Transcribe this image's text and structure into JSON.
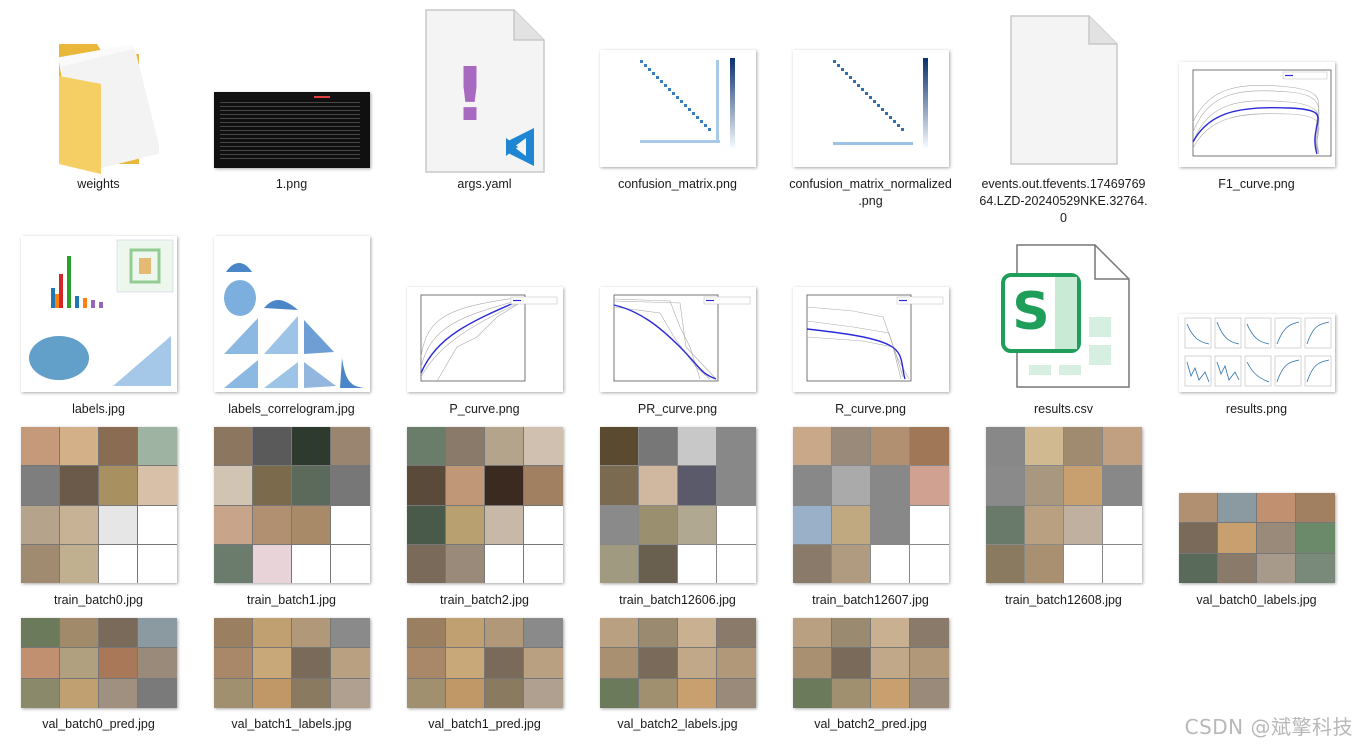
{
  "files": [
    {
      "name": "weights",
      "type": "folder"
    },
    {
      "name": "1.png",
      "type": "terminal-image"
    },
    {
      "name": "args.yaml",
      "type": "yaml-file"
    },
    {
      "name": "confusion_matrix.png",
      "type": "matrix-image"
    },
    {
      "name": "confusion_matrix_normalized.png",
      "display": "confusion_matrix_normalized\n.png",
      "type": "matrix-image"
    },
    {
      "name": "events.out.tfevents.1746976964.LZD-20240529NKE.32764.0",
      "display": "events.out.tfevents.17469769\n64.LZD-20240529NKE.32764.\n0",
      "type": "blank-file"
    },
    {
      "name": "F1_curve.png",
      "type": "curve-image"
    },
    {
      "name": "labels.jpg",
      "type": "labels-image"
    },
    {
      "name": "labels_correlogram.jpg",
      "type": "correlogram-image"
    },
    {
      "name": "P_curve.png",
      "type": "curve-image"
    },
    {
      "name": "PR_curve.png",
      "type": "curve-image"
    },
    {
      "name": "R_curve.png",
      "type": "curve-image"
    },
    {
      "name": "results.csv",
      "type": "csv-file"
    },
    {
      "name": "results.png",
      "type": "results-image"
    },
    {
      "name": "train_batch0.jpg",
      "type": "photo-mosaic"
    },
    {
      "name": "train_batch1.jpg",
      "type": "photo-mosaic"
    },
    {
      "name": "train_batch2.jpg",
      "type": "photo-mosaic"
    },
    {
      "name": "train_batch12606.jpg",
      "type": "photo-mosaic"
    },
    {
      "name": "train_batch12607.jpg",
      "type": "photo-mosaic"
    },
    {
      "name": "train_batch12608.jpg",
      "type": "photo-mosaic"
    },
    {
      "name": "val_batch0_labels.jpg",
      "type": "photo-mosaic"
    },
    {
      "name": "val_batch0_pred.jpg",
      "type": "photo-mosaic"
    },
    {
      "name": "val_batch1_labels.jpg",
      "type": "photo-mosaic"
    },
    {
      "name": "val_batch1_pred.jpg",
      "type": "photo-mosaic"
    },
    {
      "name": "val_batch2_labels.jpg",
      "type": "photo-mosaic"
    },
    {
      "name": "val_batch2_pred.jpg",
      "type": "photo-mosaic"
    }
  ],
  "csv_icon_letter": "S",
  "yaml_icon_mark": "!",
  "watermark": "CSDN @斌擎科技",
  "colors": {
    "folder": "#f2c650",
    "vscode_blue": "#1f86d3",
    "yaml_purple": "#a86ac0",
    "csv_green": "#1f9e5a",
    "curve_blue": "#2b2bd8"
  }
}
